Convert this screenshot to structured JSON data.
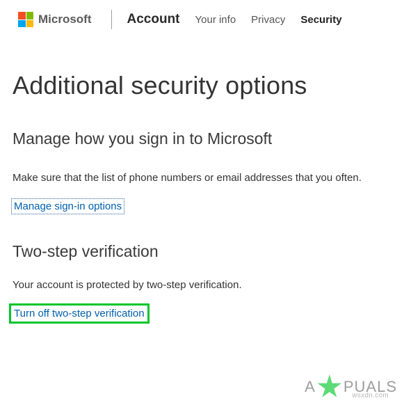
{
  "header": {
    "brand": "Microsoft",
    "nav": {
      "account": "Account",
      "items": [
        {
          "label": "Your info",
          "active": false
        },
        {
          "label": "Privacy",
          "active": false
        },
        {
          "label": "Security",
          "active": true
        }
      ]
    }
  },
  "page": {
    "title": "Additional security options"
  },
  "sections": {
    "signin": {
      "title": "Manage how you sign in to Microsoft",
      "body": "Make sure that the list of phone numbers or email addresses that you often.",
      "link": "Manage sign-in options"
    },
    "twostep": {
      "title": "Two-step verification",
      "body": "Your account is protected by two-step verification.",
      "link": "Turn off two-step verification"
    }
  },
  "watermark": {
    "text_before": "A",
    "text_after": "PUALS",
    "sub": "wsxdn.com"
  },
  "colors": {
    "link": "#0060ac",
    "highlight_green": "#00c62b",
    "text": "#333333"
  }
}
